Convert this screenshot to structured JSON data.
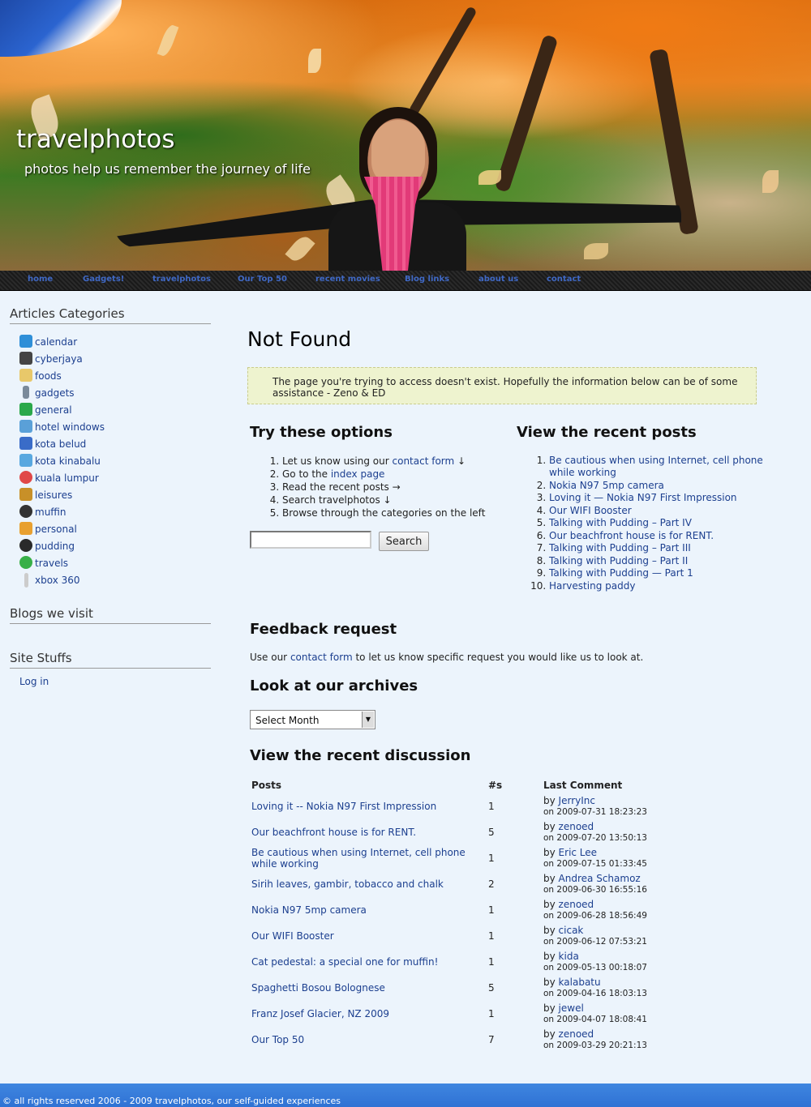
{
  "header": {
    "title": "travelphotos",
    "tagline": "photos help us remember the journey of life"
  },
  "nav": {
    "items": [
      "home",
      "Gadgets!",
      "travelphotos",
      "Our Top 50",
      "recent movies",
      "Blog links",
      "about us",
      "contact"
    ]
  },
  "sidebar": {
    "categories_heading": "Articles Categories",
    "categories": [
      {
        "label": "calendar",
        "icon": "calendar-icon",
        "color": "#2f8fd8"
      },
      {
        "label": "cyberjaya",
        "icon": "building-icon",
        "color": "#444444"
      },
      {
        "label": "foods",
        "icon": "bread-icon",
        "color": "#e8c86a"
      },
      {
        "label": "gadgets",
        "icon": "usb-icon",
        "color": "#7a8a9a"
      },
      {
        "label": "general",
        "icon": "money-icon",
        "color": "#2aa84a"
      },
      {
        "label": "hotel windows",
        "icon": "window-icon",
        "color": "#5aa0d8"
      },
      {
        "label": "kota belud",
        "icon": "house-icon",
        "color": "#3a6cc8"
      },
      {
        "label": "kota kinabalu",
        "icon": "landscape-icon",
        "color": "#58a8e0"
      },
      {
        "label": "kuala lumpur",
        "icon": "figure-icon",
        "color": "#e04848"
      },
      {
        "label": "leisures",
        "icon": "bag-icon",
        "color": "#c89028"
      },
      {
        "label": "muffin",
        "icon": "cat-icon",
        "color": "#333333"
      },
      {
        "label": "personal",
        "icon": "home-icon",
        "color": "#e8a030"
      },
      {
        "label": "pudding",
        "icon": "cat-icon",
        "color": "#2a2a2a"
      },
      {
        "label": "travels",
        "icon": "globe-icon",
        "color": "#38b048"
      },
      {
        "label": "xbox 360",
        "icon": "console-icon",
        "color": "#cccccc"
      }
    ],
    "blogs_heading": "Blogs we visit",
    "site_heading": "Site Stuffs",
    "login_label": "Log in"
  },
  "main": {
    "title": "Not Found",
    "notice": "The page you're trying to access doesn't exist. Hopefully the information below can be of some assistance - Zeno & ED",
    "options_heading": "Try these options",
    "options": [
      {
        "prefix": "Let us know using our ",
        "link": "contact form",
        "suffix": " ↓"
      },
      {
        "prefix": "Go to the ",
        "link": "index page",
        "suffix": ""
      },
      {
        "prefix": "Read the recent posts →",
        "link": "",
        "suffix": ""
      },
      {
        "prefix": "Search travelphotos ↓",
        "link": "",
        "suffix": ""
      },
      {
        "prefix": "Browse through the categories on the left",
        "link": "",
        "suffix": ""
      }
    ],
    "search_button": "Search",
    "recent_heading": "View the recent posts",
    "recent_posts": [
      "Be cautious when using Internet, cell phone while working",
      "Nokia N97 5mp camera",
      "Loving it — Nokia N97 First Impression",
      "Our WIFI Booster",
      "Talking with Pudding – Part IV",
      "Our beachfront house is for RENT.",
      "Talking with Pudding – Part III",
      "Talking with Pudding – Part II",
      "Talking with Pudding — Part 1",
      "Harvesting paddy"
    ],
    "feedback_heading": "Feedback request",
    "feedback": {
      "prefix": "Use our ",
      "link": "contact form",
      "suffix": " to let us know specific request you would like us to look at."
    },
    "archives_heading": "Look at our archives",
    "archives_select": "Select Month",
    "discussion_heading": "View the recent discussion",
    "discussion_headers": {
      "posts": "Posts",
      "count": "#s",
      "last": "Last Comment"
    },
    "discussion": [
      {
        "post": "Loving it -- Nokia N97 First Impression",
        "count": "1",
        "by": "JerryInc",
        "date": "on 2009-07-31 18:23:23"
      },
      {
        "post": "Our beachfront house is for RENT.",
        "count": "5",
        "by": "zenoed",
        "date": "on 2009-07-20 13:50:13"
      },
      {
        "post": "Be cautious when using Internet, cell phone while working",
        "count": "1",
        "by": "Eric Lee",
        "date": "on 2009-07-15 01:33:45"
      },
      {
        "post": "Sirih leaves, gambir, tobacco and chalk",
        "count": "2",
        "by": "Andrea Schamoz",
        "date": "on 2009-06-30 16:55:16"
      },
      {
        "post": "Nokia N97 5mp camera",
        "count": "1",
        "by": "zenoed",
        "date": "on 2009-06-28 18:56:49"
      },
      {
        "post": "Our WIFI Booster",
        "count": "1",
        "by": "cicak",
        "date": "on 2009-06-12 07:53:21"
      },
      {
        "post": "Cat pedestal: a special one for muffin!",
        "count": "1",
        "by": "kida",
        "date": "on 2009-05-13 00:18:07"
      },
      {
        "post": "Spaghetti Bosou Bolognese",
        "count": "5",
        "by": "kalabatu",
        "date": "on 2009-04-16 18:03:13"
      },
      {
        "post": "Franz Josef Glacier, NZ 2009",
        "count": "1",
        "by": "jewel",
        "date": "on 2009-04-07 18:08:41"
      },
      {
        "post": "Our Top 50",
        "count": "7",
        "by": "zenoed",
        "date": "on 2009-03-29 20:21:13"
      }
    ]
  },
  "footer": {
    "text": "© all rights reserved 2006 - 2009 travelphotos, our self-guided experiences"
  }
}
